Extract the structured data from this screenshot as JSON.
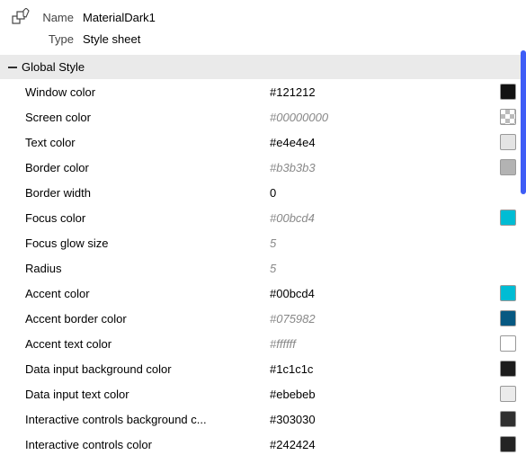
{
  "header": {
    "name_label": "Name",
    "name_value": "MaterialDark1",
    "type_label": "Type",
    "type_value": "Style sheet"
  },
  "group": {
    "title": "Global Style"
  },
  "properties": [
    {
      "label": "Window color",
      "value": "#121212",
      "is_default": false,
      "swatch": "#121212"
    },
    {
      "label": "Screen color",
      "value": "#00000000",
      "is_default": true,
      "swatch": "transparent"
    },
    {
      "label": "Text color",
      "value": "#e4e4e4",
      "is_default": false,
      "swatch": "#e4e4e4"
    },
    {
      "label": "Border color",
      "value": "#b3b3b3",
      "is_default": true,
      "swatch": "#b3b3b3"
    },
    {
      "label": "Border width",
      "value": "0",
      "is_default": false,
      "swatch": null
    },
    {
      "label": "Focus color",
      "value": "#00bcd4",
      "is_default": true,
      "swatch": "#00bcd4"
    },
    {
      "label": "Focus glow size",
      "value": "5",
      "is_default": true,
      "swatch": null
    },
    {
      "label": "Radius",
      "value": "5",
      "is_default": true,
      "swatch": null
    },
    {
      "label": "Accent color",
      "value": "#00bcd4",
      "is_default": false,
      "swatch": "#00bcd4"
    },
    {
      "label": "Accent border color",
      "value": "#075982",
      "is_default": true,
      "swatch": "#075982"
    },
    {
      "label": "Accent text color",
      "value": "#ffffff",
      "is_default": true,
      "swatch": "#ffffff"
    },
    {
      "label": "Data input background color",
      "value": "#1c1c1c",
      "is_default": false,
      "swatch": "#1c1c1c"
    },
    {
      "label": "Data input text color",
      "value": "#ebebeb",
      "is_default": false,
      "swatch": "#ebebeb"
    },
    {
      "label": "Interactive controls background c...",
      "value": "#303030",
      "is_default": false,
      "swatch": "#303030"
    },
    {
      "label": "Interactive controls color",
      "value": "#242424",
      "is_default": false,
      "swatch": "#242424"
    }
  ]
}
